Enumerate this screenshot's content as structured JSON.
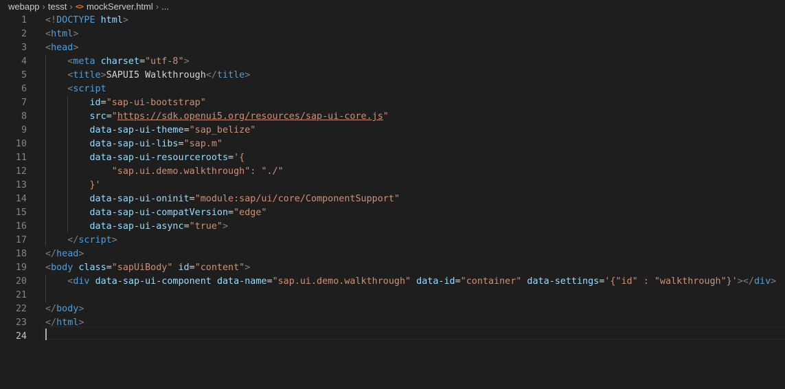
{
  "breadcrumb": {
    "items": [
      "webapp",
      "tesst",
      "mockServer.html",
      "..."
    ],
    "file_icon": "html-file-icon"
  },
  "editor": {
    "current_line": 24,
    "lines": [
      {
        "n": "1",
        "tokens": [
          {
            "t": "punc",
            "v": "<!"
          },
          {
            "t": "tag",
            "v": "DOCTYPE"
          },
          {
            "t": "text",
            "v": " "
          },
          {
            "t": "attr",
            "v": "html"
          },
          {
            "t": "punc",
            "v": ">"
          }
        ]
      },
      {
        "n": "2",
        "tokens": [
          {
            "t": "punc",
            "v": "<"
          },
          {
            "t": "tag",
            "v": "html"
          },
          {
            "t": "punc",
            "v": ">"
          }
        ]
      },
      {
        "n": "3",
        "tokens": [
          {
            "t": "punc",
            "v": "<"
          },
          {
            "t": "tag",
            "v": "head"
          },
          {
            "t": "punc",
            "v": ">"
          }
        ]
      },
      {
        "n": "4",
        "tokens": [
          {
            "t": "text",
            "v": "    "
          },
          {
            "t": "punc",
            "v": "<"
          },
          {
            "t": "tag",
            "v": "meta"
          },
          {
            "t": "text",
            "v": " "
          },
          {
            "t": "attr",
            "v": "charset"
          },
          {
            "t": "text",
            "v": "="
          },
          {
            "t": "str",
            "v": "\"utf-8\""
          },
          {
            "t": "punc",
            "v": ">"
          }
        ]
      },
      {
        "n": "5",
        "tokens": [
          {
            "t": "text",
            "v": "    "
          },
          {
            "t": "punc",
            "v": "<"
          },
          {
            "t": "tag",
            "v": "title"
          },
          {
            "t": "punc",
            "v": ">"
          },
          {
            "t": "text",
            "v": "SAPUI5 Walkthrough"
          },
          {
            "t": "punc",
            "v": "</"
          },
          {
            "t": "tag",
            "v": "title"
          },
          {
            "t": "punc",
            "v": ">"
          }
        ]
      },
      {
        "n": "6",
        "tokens": [
          {
            "t": "text",
            "v": "    "
          },
          {
            "t": "punc",
            "v": "<"
          },
          {
            "t": "tag",
            "v": "script"
          }
        ]
      },
      {
        "n": "7",
        "tokens": [
          {
            "t": "text",
            "v": "        "
          },
          {
            "t": "attr",
            "v": "id"
          },
          {
            "t": "text",
            "v": "="
          },
          {
            "t": "str",
            "v": "\"sap-ui-bootstrap\""
          }
        ]
      },
      {
        "n": "8",
        "tokens": [
          {
            "t": "text",
            "v": "        "
          },
          {
            "t": "attr",
            "v": "src"
          },
          {
            "t": "text",
            "v": "="
          },
          {
            "t": "str",
            "v": "\""
          },
          {
            "t": "link",
            "v": "https://sdk.openui5.org/resources/sap-ui-core.js"
          },
          {
            "t": "str",
            "v": "\""
          }
        ]
      },
      {
        "n": "9",
        "tokens": [
          {
            "t": "text",
            "v": "        "
          },
          {
            "t": "attr",
            "v": "data-sap-ui-theme"
          },
          {
            "t": "text",
            "v": "="
          },
          {
            "t": "str",
            "v": "\"sap_belize\""
          }
        ]
      },
      {
        "n": "10",
        "tokens": [
          {
            "t": "text",
            "v": "        "
          },
          {
            "t": "attr",
            "v": "data-sap-ui-libs"
          },
          {
            "t": "text",
            "v": "="
          },
          {
            "t": "str",
            "v": "\"sap.m\""
          }
        ]
      },
      {
        "n": "11",
        "tokens": [
          {
            "t": "text",
            "v": "        "
          },
          {
            "t": "attr",
            "v": "data-sap-ui-resourceroots"
          },
          {
            "t": "text",
            "v": "="
          },
          {
            "t": "str",
            "v": "'{"
          }
        ]
      },
      {
        "n": "12",
        "tokens": [
          {
            "t": "str",
            "v": "            \"sap.ui.demo.walkthrough\": \"./\""
          }
        ]
      },
      {
        "n": "13",
        "tokens": [
          {
            "t": "str",
            "v": "        }'"
          }
        ]
      },
      {
        "n": "14",
        "tokens": [
          {
            "t": "text",
            "v": "        "
          },
          {
            "t": "attr",
            "v": "data-sap-ui-oninit"
          },
          {
            "t": "text",
            "v": "="
          },
          {
            "t": "str",
            "v": "\"module:sap/ui/core/ComponentSupport\""
          }
        ]
      },
      {
        "n": "15",
        "tokens": [
          {
            "t": "text",
            "v": "        "
          },
          {
            "t": "attr",
            "v": "data-sap-ui-compatVersion"
          },
          {
            "t": "text",
            "v": "="
          },
          {
            "t": "str",
            "v": "\"edge\""
          }
        ]
      },
      {
        "n": "16",
        "tokens": [
          {
            "t": "text",
            "v": "        "
          },
          {
            "t": "attr",
            "v": "data-sap-ui-async"
          },
          {
            "t": "text",
            "v": "="
          },
          {
            "t": "str",
            "v": "\"true\""
          },
          {
            "t": "punc",
            "v": ">"
          }
        ]
      },
      {
        "n": "17",
        "tokens": [
          {
            "t": "text",
            "v": "    "
          },
          {
            "t": "punc",
            "v": "</"
          },
          {
            "t": "tag",
            "v": "script"
          },
          {
            "t": "punc",
            "v": ">"
          }
        ]
      },
      {
        "n": "18",
        "tokens": [
          {
            "t": "punc",
            "v": "</"
          },
          {
            "t": "tag",
            "v": "head"
          },
          {
            "t": "punc",
            "v": ">"
          }
        ]
      },
      {
        "n": "19",
        "tokens": [
          {
            "t": "punc",
            "v": "<"
          },
          {
            "t": "tag",
            "v": "body"
          },
          {
            "t": "text",
            "v": " "
          },
          {
            "t": "attr",
            "v": "class"
          },
          {
            "t": "text",
            "v": "="
          },
          {
            "t": "str",
            "v": "\"sapUiBody\""
          },
          {
            "t": "text",
            "v": " "
          },
          {
            "t": "attr",
            "v": "id"
          },
          {
            "t": "text",
            "v": "="
          },
          {
            "t": "str",
            "v": "\"content\""
          },
          {
            "t": "punc",
            "v": ">"
          }
        ]
      },
      {
        "n": "20",
        "tokens": [
          {
            "t": "text",
            "v": "    "
          },
          {
            "t": "punc",
            "v": "<"
          },
          {
            "t": "tag",
            "v": "div"
          },
          {
            "t": "text",
            "v": " "
          },
          {
            "t": "attr",
            "v": "data-sap-ui-component"
          },
          {
            "t": "text",
            "v": " "
          },
          {
            "t": "attr",
            "v": "data-name"
          },
          {
            "t": "text",
            "v": "="
          },
          {
            "t": "str",
            "v": "\"sap.ui.demo.walkthrough\""
          },
          {
            "t": "text",
            "v": " "
          },
          {
            "t": "attr",
            "v": "data-id"
          },
          {
            "t": "text",
            "v": "="
          },
          {
            "t": "str",
            "v": "\"container\""
          },
          {
            "t": "text",
            "v": " "
          },
          {
            "t": "attr",
            "v": "data-settings"
          },
          {
            "t": "text",
            "v": "="
          },
          {
            "t": "str",
            "v": "'{\"id\" : \"walkthrough\"}'"
          },
          {
            "t": "punc",
            "v": "></"
          },
          {
            "t": "tag",
            "v": "div"
          },
          {
            "t": "punc",
            "v": ">"
          }
        ]
      },
      {
        "n": "21",
        "tokens": []
      },
      {
        "n": "22",
        "tokens": [
          {
            "t": "punc",
            "v": "</"
          },
          {
            "t": "tag",
            "v": "body"
          },
          {
            "t": "punc",
            "v": ">"
          }
        ]
      },
      {
        "n": "23",
        "tokens": [
          {
            "t": "punc",
            "v": "</"
          },
          {
            "t": "tag",
            "v": "html"
          },
          {
            "t": "punc",
            "v": ">"
          }
        ]
      },
      {
        "n": "24",
        "tokens": []
      }
    ]
  }
}
